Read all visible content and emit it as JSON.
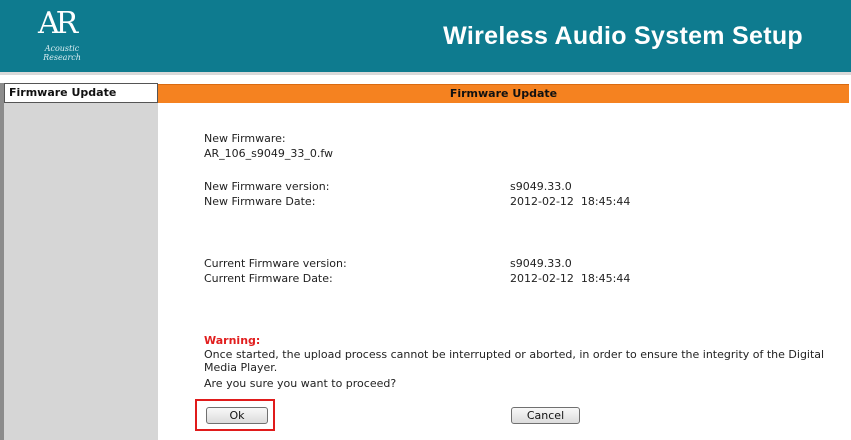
{
  "header": {
    "logo_mark": "AR",
    "logo_text": "Acoustic Research",
    "title": "Wireless Audio System Setup"
  },
  "sidebar": {
    "items": [
      {
        "label": "Firmware Update"
      }
    ]
  },
  "tab_bar": {
    "title": "Firmware Update"
  },
  "firmware": {
    "new_firmware_label": "New Firmware:",
    "new_firmware_file": "AR_106_s9049_33_0.fw",
    "new_version_label": "New Firmware version:",
    "new_version_value": "s9049.33.0",
    "new_date_label": "New Firmware Date:",
    "new_date_value": "2012-02-12  18:45:44",
    "current_version_label": "Current Firmware version:",
    "current_version_value": "s9049.33.0",
    "current_date_label": "Current Firmware Date:",
    "current_date_value": "2012-02-12  18:45:44"
  },
  "warning": {
    "label": "Warning:",
    "message": "Once started, the upload process cannot be interrupted or aborted, in order to ensure the integrity of the Digital Media Player.",
    "question": "Are you sure you want to proceed?"
  },
  "buttons": {
    "ok_label": "Ok",
    "cancel_label": "Cancel"
  },
  "colors": {
    "header_bg": "#0e7b8f",
    "tab_bar_bg": "#f58220",
    "warning": "#e11e1e",
    "highlight": "#e01b1b"
  }
}
